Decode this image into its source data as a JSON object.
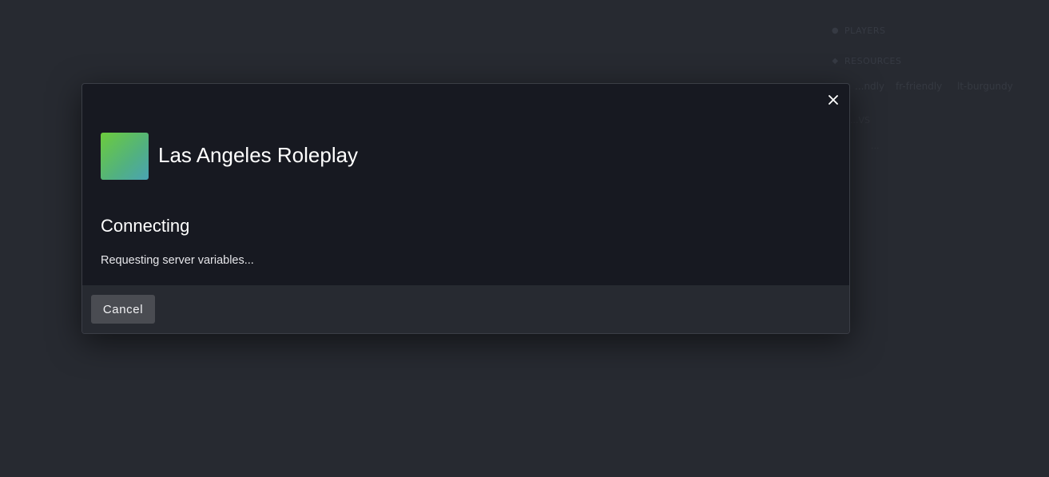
{
  "background": {
    "players_label": "PLAYERS",
    "resources_label": "RESOURCES",
    "tags": [
      "...ndly",
      "fr-friendly",
      "lt-burgundy"
    ],
    "faint_items": [
      "...VS",
      "..."
    ]
  },
  "modal": {
    "close_icon": "close-icon",
    "server_name": "Las Angeles Roleplay",
    "status_title": "Connecting",
    "status_detail": "Requesting server variables...",
    "cancel_label": "Cancel"
  },
  "colors": {
    "page_bg": "#272a31",
    "modal_bg": "#171921",
    "footer_bg": "#272a31",
    "button_bg": "#4a4c52",
    "logo_gradient_start": "#6ccc3c",
    "logo_gradient_end": "#4aa3b4"
  }
}
